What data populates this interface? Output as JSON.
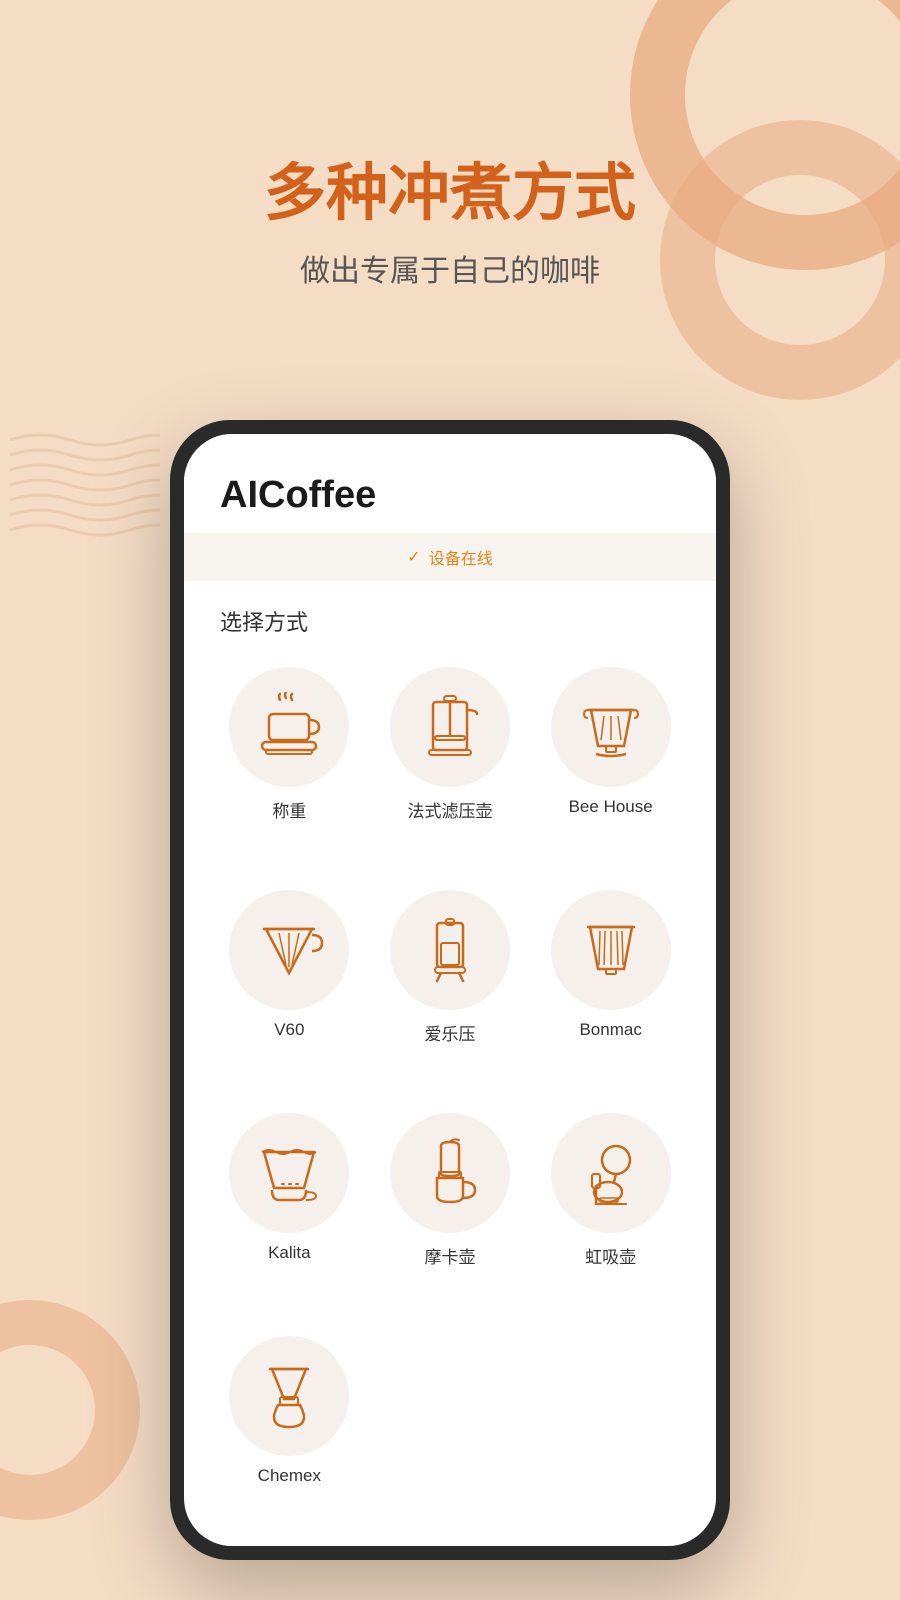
{
  "background": {
    "color": "#f5dcc5",
    "accent_color": "#e8a87c"
  },
  "hero": {
    "title": "多种冲煮方式",
    "subtitle": "做出专属于自己的咖啡"
  },
  "app": {
    "title": "AICoffee",
    "status_icon": "✓",
    "status_text": "设备在线",
    "section_label": "选择方式",
    "methods": [
      {
        "id": "scale",
        "label": "称重",
        "icon": "scale"
      },
      {
        "id": "french-press",
        "label": "法式滤压壶",
        "icon": "french-press"
      },
      {
        "id": "bee-house",
        "label": "Bee House",
        "icon": "bee-house"
      },
      {
        "id": "v60",
        "label": "V60",
        "icon": "v60"
      },
      {
        "id": "aeropress",
        "label": "爱乐压",
        "icon": "aeropress"
      },
      {
        "id": "bonmac",
        "label": "Bonmac",
        "icon": "bonmac"
      },
      {
        "id": "kalita",
        "label": "Kalita",
        "icon": "kalita"
      },
      {
        "id": "moka-pot",
        "label": "摩卡壶",
        "icon": "moka-pot"
      },
      {
        "id": "syphon",
        "label": "虹吸壶",
        "icon": "syphon"
      },
      {
        "id": "chemex",
        "label": "Chemex",
        "icon": "chemex"
      }
    ]
  },
  "icon_color": "#c96a1a"
}
